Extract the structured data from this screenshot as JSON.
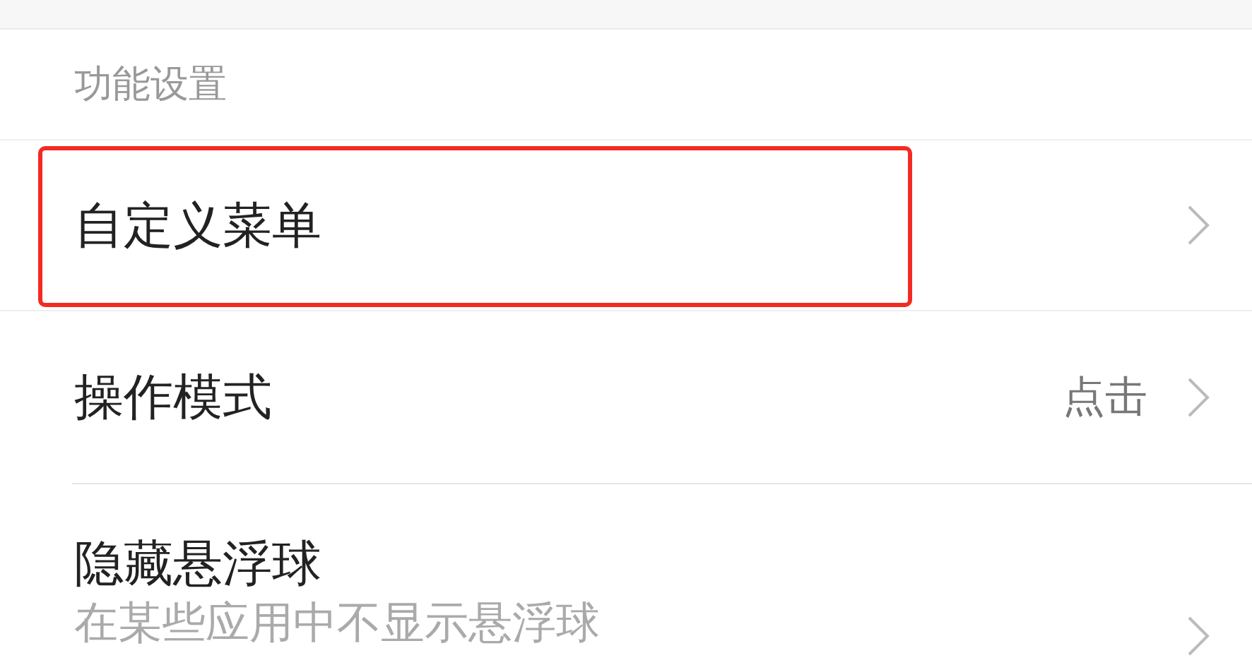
{
  "section_header": "功能设置",
  "items": [
    {
      "kind": "link",
      "title": "自定义菜单",
      "highlighted": true
    },
    {
      "kind": "value",
      "title": "操作模式",
      "value": "点击",
      "highlighted": false
    },
    {
      "kind": "subtitle",
      "title": "隐藏悬浮球",
      "subtitle": "在某些应用中不显示悬浮球",
      "highlighted": false
    }
  ]
}
